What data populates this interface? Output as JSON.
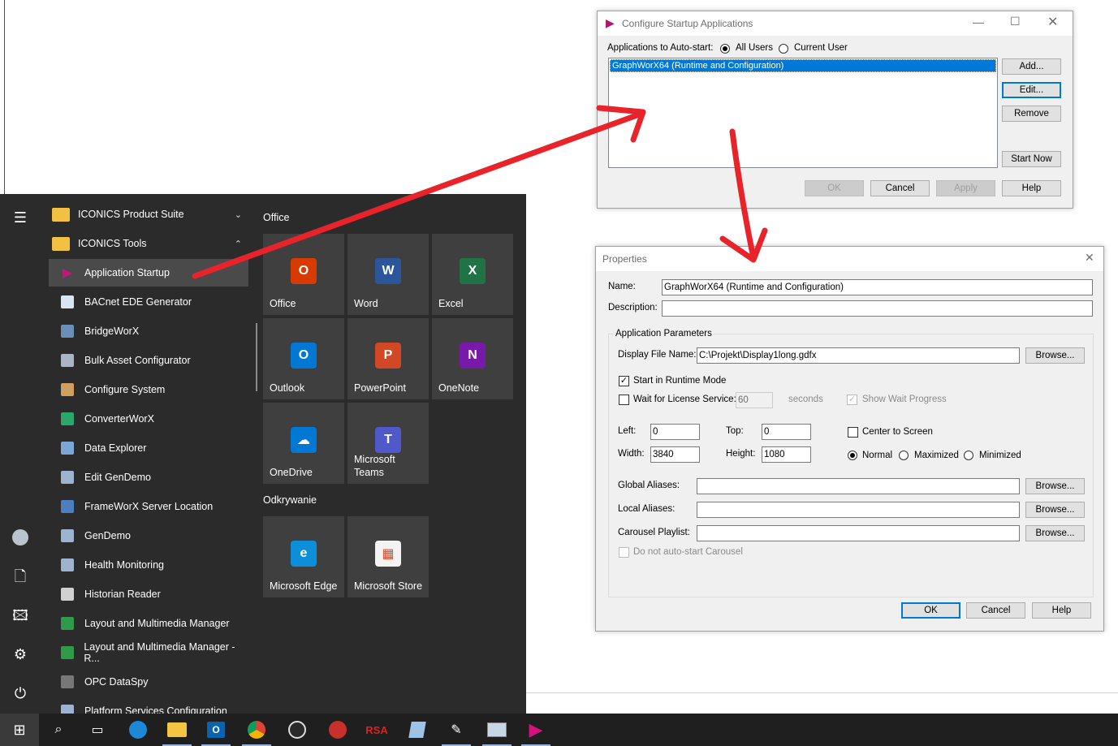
{
  "start_menu": {
    "app_list": [
      {
        "label": "ICONICS Product Suite",
        "icon": "folder-icon",
        "type": "folder",
        "chevron": "⌄"
      },
      {
        "label": "ICONICS Tools",
        "icon": "folder-icon",
        "type": "folder",
        "chevron": "⌃"
      },
      {
        "label": "Application Startup",
        "icon": "play-triangle-icon",
        "type": "app",
        "selected": true
      },
      {
        "label": "BACnet EDE Generator",
        "icon": "document-icon",
        "type": "app"
      },
      {
        "label": "BridgeWorX",
        "icon": "bridge-icon",
        "type": "app"
      },
      {
        "label": "Bulk Asset Configurator",
        "icon": "asset-icon",
        "type": "app"
      },
      {
        "label": "Configure System",
        "icon": "tools-icon",
        "type": "app"
      },
      {
        "label": "ConverterWorX",
        "icon": "converter-icon",
        "type": "app"
      },
      {
        "label": "Data Explorer",
        "icon": "grid-icon",
        "type": "app"
      },
      {
        "label": "Edit GenDemo",
        "icon": "pen-icon",
        "type": "app"
      },
      {
        "label": "FrameWorX Server Location",
        "icon": "server-icon",
        "type": "app"
      },
      {
        "label": "GenDemo",
        "icon": "pen-icon",
        "type": "app"
      },
      {
        "label": "Health Monitoring",
        "icon": "pen-icon",
        "type": "app"
      },
      {
        "label": "Historian Reader",
        "icon": "historian-icon",
        "type": "app"
      },
      {
        "label": "Layout and Multimedia Manager",
        "icon": "globe-icon",
        "type": "app"
      },
      {
        "label": "Layout and Multimedia Manager - R...",
        "icon": "globe-icon",
        "type": "app"
      },
      {
        "label": "OPC DataSpy",
        "icon": "spy-icon",
        "type": "app"
      },
      {
        "label": "Platform Services Configuration",
        "icon": "pen-icon",
        "type": "app"
      }
    ],
    "groups": [
      {
        "title": "Office"
      },
      {
        "title": "Odkrywanie"
      }
    ],
    "tiles": [
      {
        "label": "Office",
        "glyph": "O",
        "color": "#d83b01"
      },
      {
        "label": "Word",
        "glyph": "W",
        "color": "#2b579a"
      },
      {
        "label": "Excel",
        "glyph": "X",
        "color": "#217346"
      },
      {
        "label": "Outlook",
        "glyph": "O",
        "color": "#0078d4"
      },
      {
        "label": "PowerPoint",
        "glyph": "P",
        "color": "#d24726"
      },
      {
        "label": "OneNote",
        "glyph": "N",
        "color": "#7719aa"
      },
      {
        "label": "OneDrive",
        "glyph": "☁",
        "color": "#0078d4"
      },
      {
        "label": "Microsoft Teams",
        "glyph": "T",
        "color": "#5059c9"
      },
      {
        "label": "Microsoft Edge",
        "glyph": "e",
        "color": "#0c8fd8"
      },
      {
        "label": "Microsoft Store",
        "glyph": "▦",
        "color": "#f3f3f3"
      }
    ],
    "rail_icons": [
      "hamburger-menu-icon",
      "user-avatar-icon",
      "documents-icon",
      "pictures-icon",
      "settings-gear-icon",
      "power-icon"
    ]
  },
  "taskbar": {
    "icons": [
      "windows-start-icon",
      "search-icon",
      "task-view-icon",
      "edge-icon",
      "file-explorer-icon",
      "outlook-icon",
      "chrome-icon",
      "obs-icon",
      "app-bird-icon",
      "rsa-icon",
      "notebook-icon",
      "pen-app-icon",
      "monitor-app-icon",
      "play-triangle-icon"
    ],
    "rsa_text": "RSA"
  },
  "configure_dialog": {
    "title": "Configure Startup Applications",
    "auto_start_label": "Applications to Auto-start:",
    "radio_all_users": "All Users",
    "radio_current_user": "Current User",
    "list_items": [
      "GraphWorX64 (Runtime and Configuration)"
    ],
    "btn_add": "Add...",
    "btn_edit": "Edit...",
    "btn_remove": "Remove",
    "btn_start_now": "Start Now",
    "btn_ok": "OK",
    "btn_cancel": "Cancel",
    "btn_apply": "Apply",
    "btn_help": "Help"
  },
  "properties_dialog": {
    "title": "Properties",
    "name_label": "Name:",
    "name_value": "GraphWorX64 (Runtime and Configuration)",
    "description_label": "Description:",
    "description_value": "",
    "group_title": "Application Parameters",
    "display_file_label": "Display File Name:",
    "display_file_value": "C:\\Projekt\\Display1long.gdfx",
    "browse": "Browse...",
    "start_runtime_label": "Start in Runtime Mode",
    "wait_license_label": "Wait for License Service:",
    "wait_value": "60",
    "seconds_label": "seconds",
    "show_wait_label": "Show Wait Progress",
    "left_label": "Left:",
    "left_value": "0",
    "top_label": "Top:",
    "top_value": "0",
    "width_label": "Width:",
    "width_value": "3840",
    "height_label": "Height:",
    "height_value": "1080",
    "center_label": "Center to Screen",
    "normal_label": "Normal",
    "maximized_label": "Maximized",
    "minimized_label": "Minimized",
    "global_aliases_label": "Global Aliases:",
    "local_aliases_label": "Local Aliases:",
    "carousel_label": "Carousel Playlist:",
    "no_carousel_label": "Do not auto-start Carousel",
    "btn_ok": "OK",
    "btn_cancel": "Cancel",
    "btn_help": "Help"
  },
  "colors": {
    "annotation_arrow": "#e8232a",
    "selection": "#0078d7",
    "start_bg": "#2b2b2b",
    "tile_bg": "#3f3f3f"
  }
}
